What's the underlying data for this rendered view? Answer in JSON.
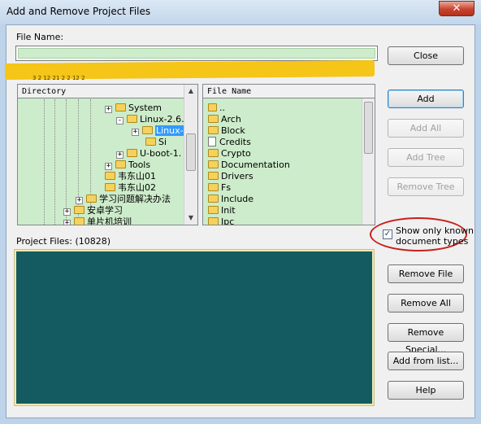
{
  "window": {
    "title": "Add and Remove Project Files",
    "close_glyph": "✕"
  },
  "filename": {
    "label": "File Name:",
    "value": ""
  },
  "obscured_path": "3 2 12 21  2 2 12 2",
  "directory": {
    "header": "Directory",
    "items": [
      {
        "label": "System",
        "type": "folder",
        "expander": "+"
      },
      {
        "label": "Linux-2.6.",
        "type": "folder",
        "expander": "-"
      },
      {
        "label": "Linux-",
        "type": "folder",
        "expander": "+",
        "selected": true
      },
      {
        "label": "Si",
        "type": "folder",
        "expander": ""
      },
      {
        "label": "U-boot-1.",
        "type": "folder",
        "expander": "+"
      },
      {
        "label": "Tools",
        "type": "folder",
        "expander": "+"
      },
      {
        "label": "韦东山01",
        "type": "folder",
        "expander": ""
      },
      {
        "label": "韦东山02",
        "type": "folder",
        "expander": ""
      },
      {
        "label": "学习问题解决办法",
        "type": "folder",
        "expander": "+"
      },
      {
        "label": "安卓学习",
        "type": "folder",
        "expander": "+"
      },
      {
        "label": "单片机培训",
        "type": "folder",
        "expander": "+"
      }
    ]
  },
  "filelist": {
    "header": "File Name",
    "items": [
      {
        "label": "..",
        "type": "up"
      },
      {
        "label": "Arch",
        "type": "folder"
      },
      {
        "label": "Block",
        "type": "folder"
      },
      {
        "label": "Credits",
        "type": "file"
      },
      {
        "label": "Crypto",
        "type": "folder"
      },
      {
        "label": "Documentation",
        "type": "folder"
      },
      {
        "label": "Drivers",
        "type": "folder"
      },
      {
        "label": "Fs",
        "type": "folder"
      },
      {
        "label": "Include",
        "type": "folder"
      },
      {
        "label": "Init",
        "type": "folder"
      },
      {
        "label": "Ipc",
        "type": "folder"
      }
    ]
  },
  "project_files": {
    "label": "Project Files: (10828)",
    "items": []
  },
  "show_known": {
    "label_line1": "Show only known",
    "label_line2": "document types",
    "checked": true,
    "check_glyph": "✓"
  },
  "buttons": {
    "close": "Close",
    "add": "Add",
    "add_all": "Add All",
    "add_tree": "Add Tree",
    "remove_tree": "Remove Tree",
    "remove_file": "Remove File",
    "remove_all": "Remove All",
    "remove_special": "Remove Special...",
    "add_from_list": "Add from list...",
    "help": "Help"
  },
  "colors": {
    "list_bg": "#cdeccb",
    "project_bg": "#135b60",
    "annotation_red": "#c8201c",
    "highlight_yellow": "#f5c518"
  }
}
